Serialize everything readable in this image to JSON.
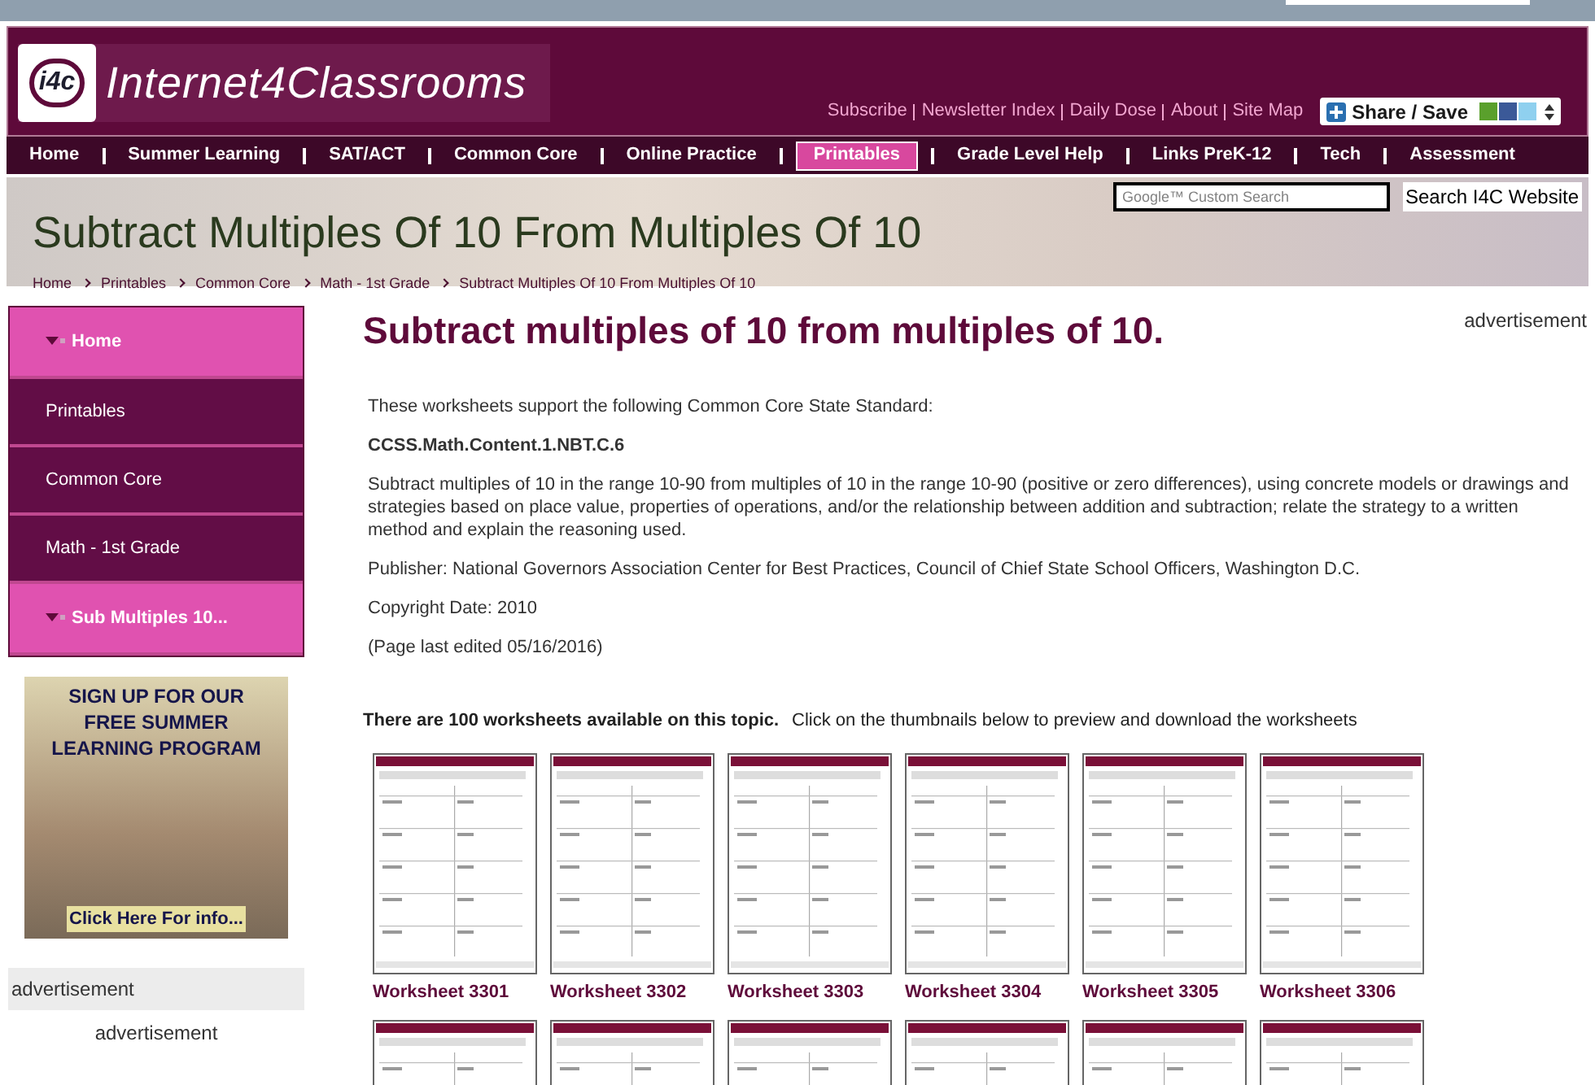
{
  "header": {
    "logo_badge": "i4c",
    "site_name": "Internet4Classrooms",
    "links": [
      "Subscribe",
      "Newsletter Index",
      "Daily Dose",
      "About",
      "Site Map"
    ],
    "share": "Share / Save"
  },
  "nav": [
    {
      "label": "Home",
      "selected": false
    },
    {
      "label": "Summer Learning",
      "selected": false
    },
    {
      "label": "SAT/ACT",
      "selected": false
    },
    {
      "label": "Common Core",
      "selected": false
    },
    {
      "label": "Online Practice",
      "selected": false
    },
    {
      "label": "Printables",
      "selected": true
    },
    {
      "label": "Grade Level Help",
      "selected": false
    },
    {
      "label": "Links PreK-12",
      "selected": false
    },
    {
      "label": "Tech",
      "selected": false
    },
    {
      "label": "Assessment",
      "selected": false
    }
  ],
  "banner": {
    "title": "Subtract Multiples Of 10 From Multiples Of 10",
    "search_placeholder": "Google™ Custom Search",
    "search_button": "Search I4C Website",
    "breadcrumb": [
      "Home",
      "Printables",
      "Common Core",
      "Math - 1st Grade",
      "Subtract Multiples Of 10 From Multiples Of 10"
    ]
  },
  "sidebar": {
    "items": [
      {
        "label": "Home",
        "selected": true
      },
      {
        "label": "Printables",
        "selected": false
      },
      {
        "label": "Common Core",
        "selected": false
      },
      {
        "label": "Math - 1st Grade",
        "selected": false
      },
      {
        "label": "Sub Multiples 10...",
        "selected": true
      }
    ],
    "promo": [
      "SIGN UP FOR OUR",
      "FREE SUMMER",
      "LEARNING PROGRAM",
      "Click Here For info..."
    ],
    "ad_label": "advertisement",
    "ad_label_2": "advertisement"
  },
  "main": {
    "heading": "Subtract multiples of 10 from multiples of 10.",
    "ad_label": "advertisement",
    "paragraphs": [
      {
        "kind": "text",
        "text": "These worksheets support the following Common Core State Standard:"
      },
      {
        "kind": "bold",
        "text": "CCSS.Math.Content.1.NBT.C.6"
      },
      {
        "kind": "text",
        "text": "Subtract multiples of 10 in the range 10-90 from multiples of 10 in the range 10-90 (positive or zero differences), using concrete models or drawings and strategies based on place value, properties of operations, and/or the relationship between addition and subtraction; relate the strategy to a written method and explain the reasoning used."
      },
      {
        "kind": "text",
        "text": "Publisher: National Governors Association Center for Best Practices, Council of Chief State School Officers, Washington D.C."
      },
      {
        "kind": "text",
        "text": "Copyright Date: 2010"
      },
      {
        "kind": "text",
        "text": "(Page last edited 05/16/2016)"
      }
    ],
    "count_text": "There are 100 worksheets available on this topic.",
    "instruction": "Click on the thumbnails below to preview and download the worksheets",
    "worksheets": [
      {
        "kind": "titled",
        "title": "Worksheet 3301"
      },
      {
        "kind": "titled",
        "title": "Worksheet 3302"
      },
      {
        "kind": "titled",
        "title": "Worksheet 3303"
      },
      {
        "kind": "titled",
        "title": "Worksheet 3304"
      },
      {
        "kind": "titled",
        "title": "Worksheet 3305"
      },
      {
        "kind": "titled",
        "title": "Worksheet 3306"
      },
      {
        "kind": "thumbnail"
      },
      {
        "kind": "thumbnail"
      },
      {
        "kind": "thumbnail"
      },
      {
        "kind": "thumbnail"
      },
      {
        "kind": "thumbnail"
      },
      {
        "kind": "thumbnail"
      }
    ]
  }
}
